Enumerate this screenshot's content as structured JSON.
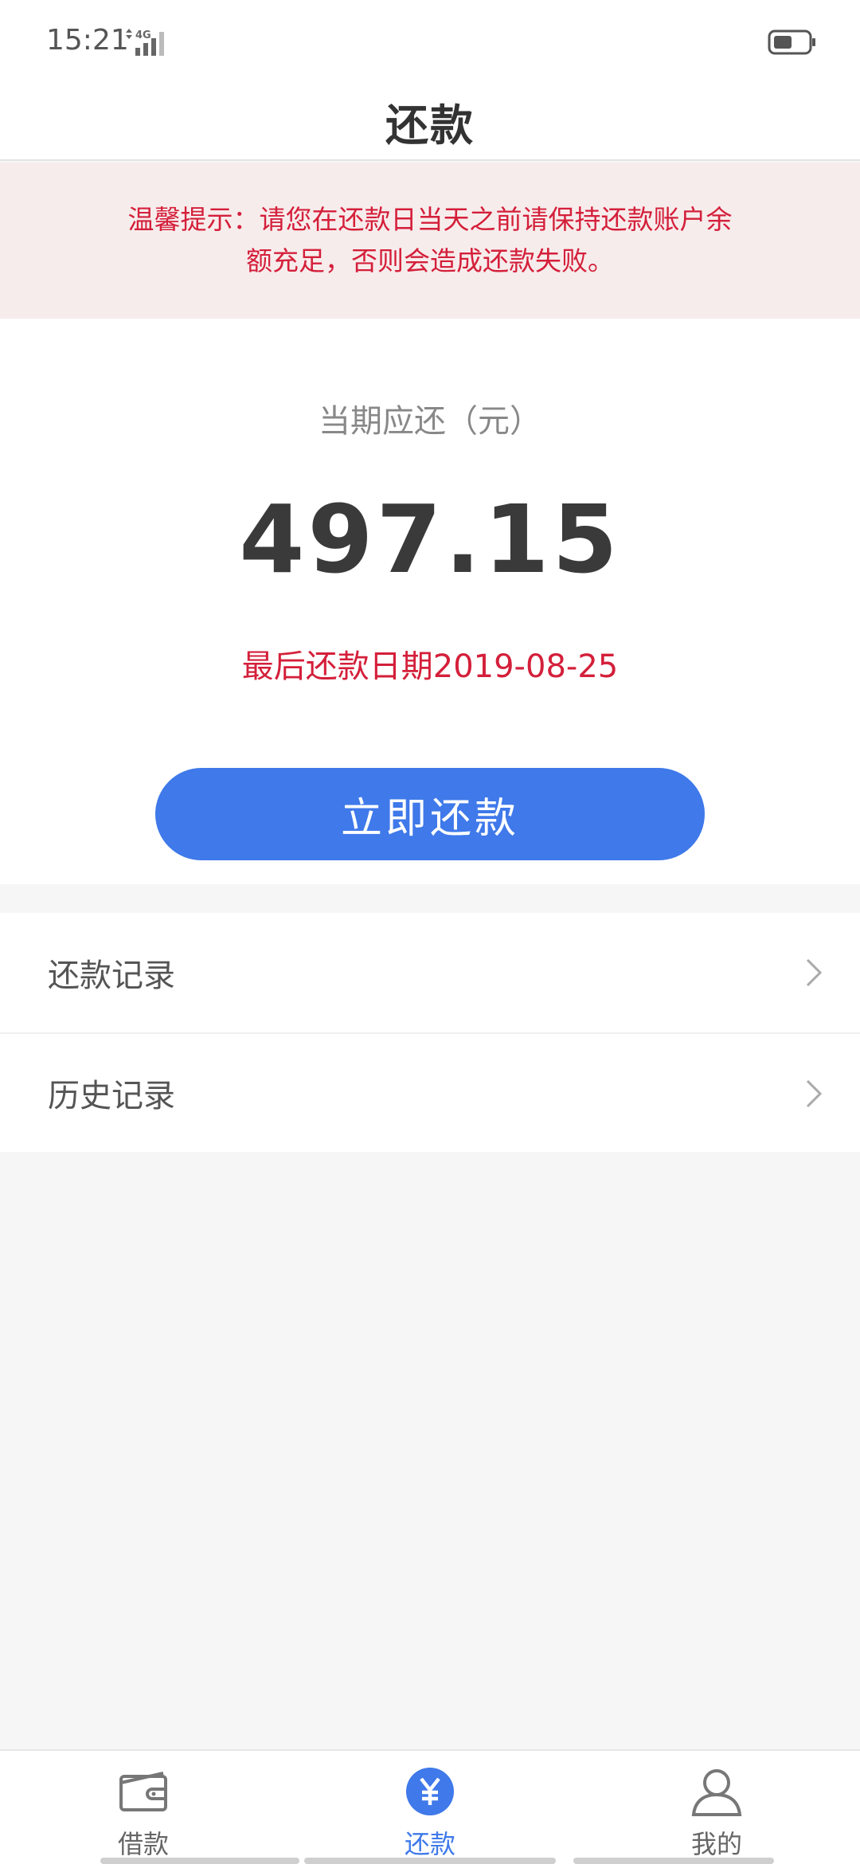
{
  "status_bar": {
    "time": "15:21",
    "network": "4G"
  },
  "header": {
    "title": "还款"
  },
  "notice": {
    "text": "温馨提示：请您在还款日当天之前请保持还款账户余额充足，否则会造成还款失败。"
  },
  "repayment": {
    "amount_label": "当期应还（元）",
    "amount": "497.15",
    "due_date_text": "最后还款日期2019-08-25",
    "button_label": "立即还款"
  },
  "menu": {
    "items": [
      {
        "label": "还款记录",
        "icon": "chevron-right-icon"
      },
      {
        "label": "历史记录",
        "icon": "chevron-right-icon"
      }
    ]
  },
  "bottom_nav": {
    "items": [
      {
        "label": "借款",
        "icon": "wallet-icon",
        "active": false
      },
      {
        "label": "还款",
        "icon": "yen-circle-icon",
        "active": true
      },
      {
        "label": "我的",
        "icon": "user-icon",
        "active": false
      }
    ]
  },
  "colors": {
    "accent": "#3f79ea",
    "warning_text": "#d41f3a",
    "notice_bg": "#f7ecec",
    "page_bg": "#f6f6f6"
  }
}
